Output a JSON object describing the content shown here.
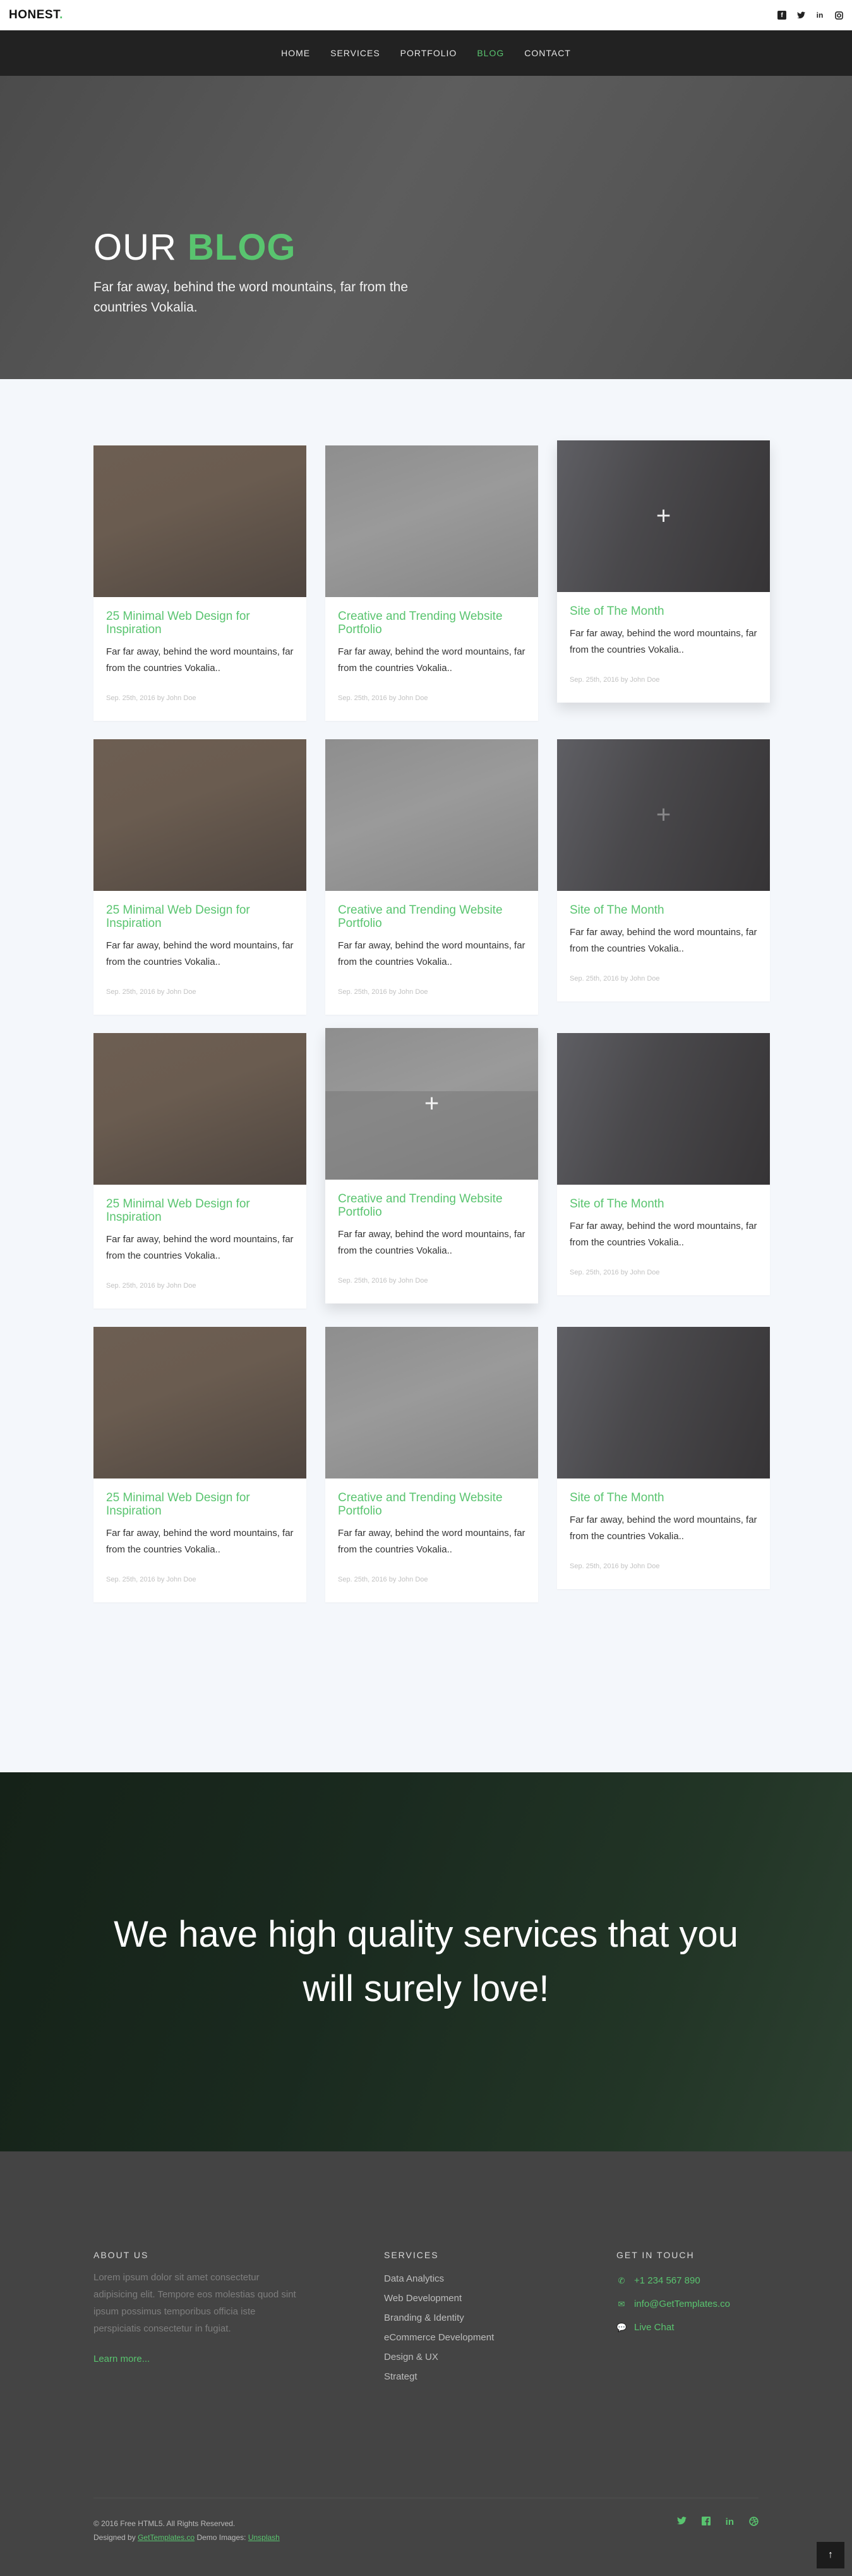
{
  "header": {
    "brand": "HONEST",
    "brand_dot": ".",
    "social": [
      "facebook-icon",
      "twitter-icon",
      "linkedin-icon",
      "instagram-icon"
    ]
  },
  "nav": {
    "items": [
      {
        "label": "HOME",
        "active": false
      },
      {
        "label": "SERVICES",
        "active": false
      },
      {
        "label": "PORTFOLIO",
        "active": false
      },
      {
        "label": "BLOG",
        "active": true
      },
      {
        "label": "CONTACT",
        "active": false
      }
    ]
  },
  "hero": {
    "title_plain": "OUR ",
    "title_accent": "BLOG",
    "subtitle": "Far far away, behind the word mountains, far from the countries Vokalia."
  },
  "posts": {
    "a": {
      "title": "25 Minimal Web Design for Inspiration",
      "desc": "Far far away, behind the word mountains, far from the countries Vokalia..",
      "meta": "Sep. 25th, 2016 by John Doe"
    },
    "b": {
      "title": "Creative and Trending Website Portfolio",
      "desc": "Far far away, behind the word mountains, far from the countries Vokalia..",
      "meta": "Sep. 25th, 2016 by John Doe"
    },
    "c": {
      "title": "Site of The Month",
      "desc": "Far far away, behind the word mountains, far from the countries Vokalia..",
      "meta": "Sep. 25th, 2016 by John Doe"
    },
    "plus": "+"
  },
  "banner": {
    "text": "We have high quality services that you will surely love!"
  },
  "footer": {
    "about": {
      "heading": "ABOUT US",
      "text": "Lorem ipsum dolor sit amet consectetur adipisicing elit. Tempore eos molestias quod sint ipsum possimus temporibus officia iste perspiciatis consectetur in fugiat.",
      "link": "Learn more..."
    },
    "services": {
      "heading": "SERVICES",
      "items": [
        "Data Analytics",
        "Web Development",
        "Branding & Identity",
        "eCommerce Development",
        "Design & UX",
        "Strategt"
      ]
    },
    "contact": {
      "heading": "GET IN TOUCH",
      "phone": "+1 234 567 890",
      "email": "info@GetTemplates.co",
      "chat": "Live Chat"
    },
    "copyright": "© 2016 Free HTML5. All Rights Reserved.",
    "designed_prefix": "Designed by",
    "designed_by": "GetTemplates.co",
    "demo_prefix": "Demo Images:",
    "demo_images": "Unsplash",
    "social": [
      "twitter-icon",
      "facebook-icon",
      "linkedin-icon",
      "dribbble-icon"
    ],
    "back_to_top": "↑"
  }
}
